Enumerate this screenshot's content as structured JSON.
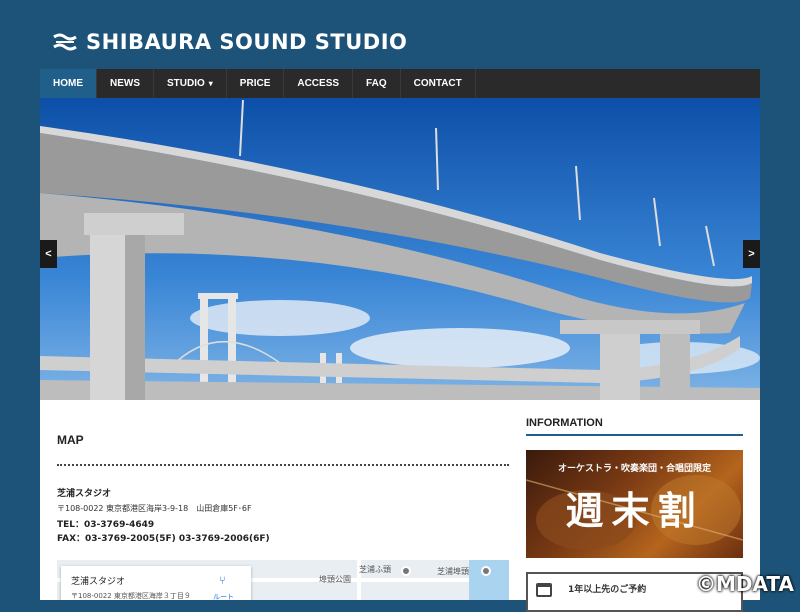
{
  "header": {
    "logo_text": "SHIBAURA SOUND STUDIO"
  },
  "nav": {
    "items": [
      {
        "label": "HOME",
        "active": true
      },
      {
        "label": "NEWS"
      },
      {
        "label": "STUDIO",
        "caret": "▾"
      },
      {
        "label": "PRICE"
      },
      {
        "label": "ACCESS"
      },
      {
        "label": "FAQ"
      },
      {
        "label": "CONTACT"
      }
    ]
  },
  "slider": {
    "prev_label": "<",
    "next_label": ">"
  },
  "main": {
    "map_title": "MAP",
    "studio_name": "芝浦スタジオ",
    "address": "〒108-0022 東京都港区海岸3-9-18　山田倉庫5F･6F",
    "tel": "TEL：03-3769-4649",
    "fax": "FAX：03-3769-2005(5F)  03-3769-2006(6F)"
  },
  "map_embed": {
    "card_name": "芝浦スタジオ",
    "card_address": "〒108-0022 東京都港区海岸３丁目９",
    "route_label": "ルート",
    "labels": [
      "埠頭公園",
      "芝浦ふ頭",
      "芝浦埠頭"
    ]
  },
  "sidebar": {
    "info_title": "INFORMATION",
    "banner_subtitle": "オーケストラ・吹奏楽団・合唱団限定",
    "banner_title": "週末割",
    "notice_text": "1年以上先のご予約"
  },
  "watermark": "©MDATA",
  "colors": {
    "page_background": "#1d5378",
    "nav_background": "#2a2a2a",
    "nav_active": "#1f5f8a",
    "content_background": "#ffffff"
  }
}
